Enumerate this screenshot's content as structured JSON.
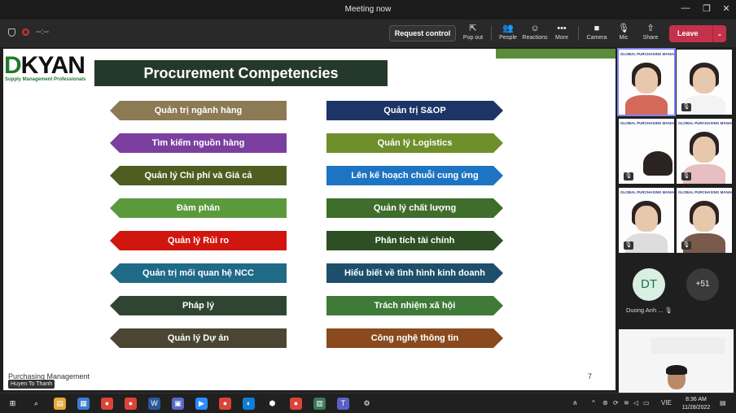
{
  "window": {
    "title": "Meeting now",
    "minimize": "—",
    "maximize": "❐",
    "close": "✕"
  },
  "toolbar": {
    "timer": "--:--",
    "request_control": "Request control",
    "buttons": [
      {
        "label": "Pop out",
        "icon": "⇱"
      },
      {
        "label": "People",
        "icon": "👥"
      },
      {
        "label": "Reactions",
        "icon": "☺"
      },
      {
        "label": "More",
        "icon": "•••"
      },
      {
        "label": "Camera",
        "icon": "■"
      },
      {
        "label": "Mic",
        "icon": "🎙"
      },
      {
        "label": "Share",
        "icon": "⇧"
      }
    ],
    "leave": "Leave",
    "leave_dropdown": "⌄"
  },
  "slide": {
    "logo_text": "KYAN",
    "logo_prefix": "D",
    "logo_tagline": "Supply Management Professionals",
    "title": "Procurement Competencies",
    "left_items": [
      {
        "label": "Quản trị ngành hàng",
        "color": "#8c7a55"
      },
      {
        "label": "Tìm kiếm nguồn hàng",
        "color": "#7b3fa0"
      },
      {
        "label": "Quản lý Chi phí và Giá cả",
        "color": "#4f5d20"
      },
      {
        "label": "Đàm phán",
        "color": "#5a9a3c"
      },
      {
        "label": "Quản lý Rủi ro",
        "color": "#d1160f"
      },
      {
        "label": "Quản trị mối quan hệ NCC",
        "color": "#1f6a86"
      },
      {
        "label": "Pháp lý",
        "color": "#2f4532"
      },
      {
        "label": "Quản lý Dự án",
        "color": "#4a4633"
      }
    ],
    "right_items": [
      {
        "label": "Quản trị S&OP",
        "color": "#1d3466"
      },
      {
        "label": "Quản lý Logistics",
        "color": "#6f8f2d"
      },
      {
        "label": "Lên kế hoạch chuỗi cung ứng",
        "color": "#1d74c2"
      },
      {
        "label": "Quản lý chất lượng",
        "color": "#3f6d2c"
      },
      {
        "label": "Phân tích tài chính",
        "color": "#2e4f24"
      },
      {
        "label": "Hiểu biết về tình hình kinh doanh",
        "color": "#1d4f6b"
      },
      {
        "label": "Trách nhiệm xã hội",
        "color": "#3f7a38"
      },
      {
        "label": "Công nghệ thông tin",
        "color": "#8a4a1e"
      }
    ],
    "footer": "Purchasing Management",
    "page_number": "7",
    "presenter": "Huyen To Thanh"
  },
  "participants": {
    "tile_header": "GLOBAL PURCHASING MANAGEMENT",
    "initials": "DT",
    "name": "Duong Anh ...",
    "overflow": "+51",
    "mic_icon": "🎙"
  },
  "taskbar": {
    "apps": [
      {
        "icon": "⊞",
        "color": "#202020"
      },
      {
        "icon": "⌕",
        "color": "#202020"
      },
      {
        "icon": "▤",
        "color": "#e6a93a"
      },
      {
        "icon": "▦",
        "color": "#3b7bd4"
      },
      {
        "icon": "●",
        "color": "#db4437"
      },
      {
        "icon": "●",
        "color": "#db4437"
      },
      {
        "icon": "W",
        "color": "#2b579a"
      },
      {
        "icon": "▣",
        "color": "#5a6ac4"
      },
      {
        "icon": "▶",
        "color": "#2d8cff"
      },
      {
        "icon": "●",
        "color": "#db4437"
      },
      {
        "icon": "◐",
        "color": "#0f7fd6"
      },
      {
        "icon": "⬢",
        "color": "#222"
      },
      {
        "icon": "●",
        "color": "#db4437"
      },
      {
        "icon": "▥",
        "color": "#3a7a5a"
      },
      {
        "icon": "T",
        "color": "#5b5fc7"
      },
      {
        "icon": "⚙",
        "color": "#202020"
      }
    ],
    "lang": "VIE",
    "time": "8:36 AM",
    "date": "11/28/2022"
  }
}
